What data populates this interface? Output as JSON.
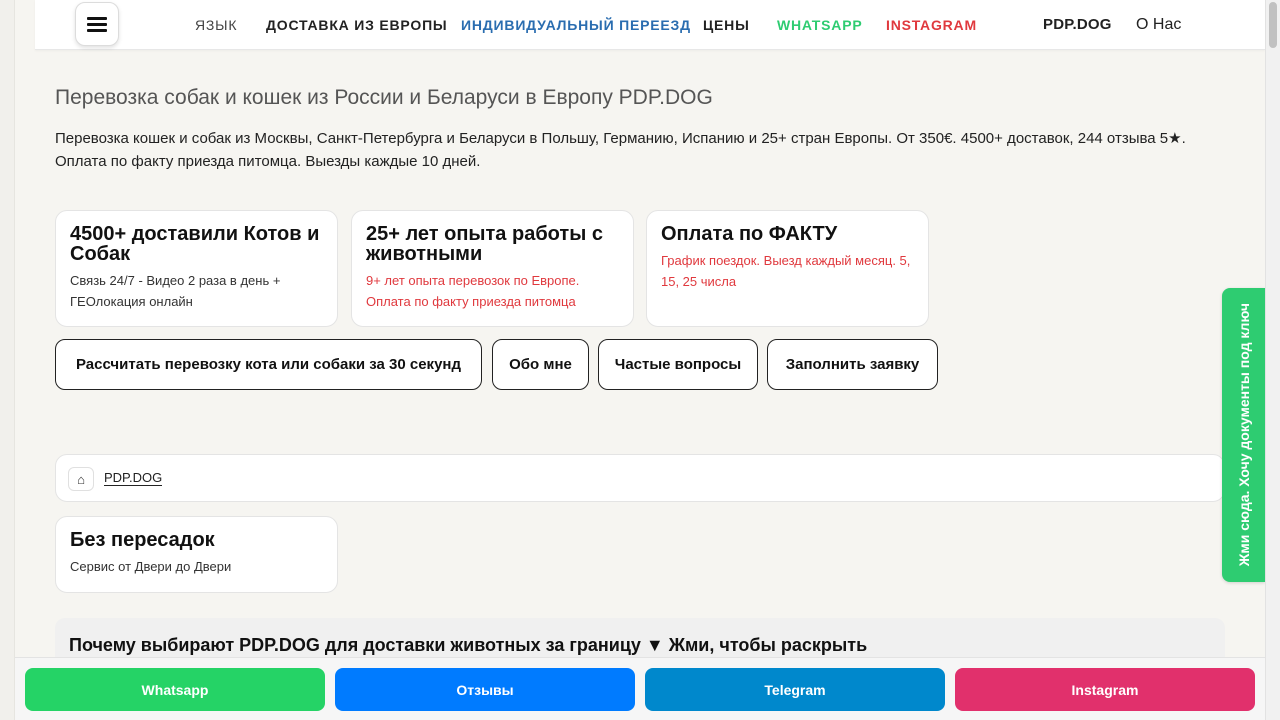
{
  "nav": {
    "menu_icon": "hamburger-menu-icon",
    "links": {
      "lang": "ЯЗЫК",
      "delivery": "ДОСТАВКА ИЗ ЕВРОПЫ",
      "individual": "ИНДИВИДУАЛЬНЫЙ ПЕРЕЕЗД",
      "prices": "ЦЕНЫ",
      "whatsapp": "WHATSAPP",
      "instagram": "INSTAGRAM",
      "brand": "PDP.DOG",
      "about": "О Нас"
    },
    "colors": {
      "individual": "#2a6db0",
      "whatsapp": "#2ecc71",
      "instagram": "#e0393e"
    }
  },
  "hero": {
    "title": "Перевозка собак и кошек из России и Беларуси в Европу PDP.DOG",
    "description": "Перевозка кошек и собак из Москвы, Санкт-Петербурга и Беларуси в Польшу, Германию, Испанию и 25+ стран Европы. От 350€. 4500+ доставок, 244 отзыва 5★. Оплата по факту приезда питомца. Выезды каждые 10 дней."
  },
  "cards": [
    {
      "title": "4500+ доставили Котов и Собак",
      "text": "Связь 24/7 - Видео 2 раза в день + ГЕОлокация онлайн"
    },
    {
      "title": "25+ лет опыта работы с животными",
      "text": "9+ лет опыта перевозок по Европе. Оплата по факту приезда питомца"
    },
    {
      "title": "Оплата по ФАКТУ",
      "text": "График поездок. Выезд каждый месяц. 5, 15, 25 числа"
    }
  ],
  "actions": {
    "calc": "Рассчитать перевозку кота или собаки за 30 секунд",
    "about": "Обо мне",
    "faq": "Частые вопросы",
    "apply": "Заполнить заявку"
  },
  "breadcrumb": {
    "home_icon": "home-icon",
    "home_glyph": "⌂",
    "current": "PDP.DOG"
  },
  "feature_card": {
    "title": "Без пересадок",
    "text": "Сервис от Двери до Двери"
  },
  "faq_toggle": {
    "text": "Почему выбирают PDP.DOG для доставки животных за границу ▼ Жми, чтобы раскрыть"
  },
  "side_tab": {
    "text": "Жми сюда. Хочу документы под ключ"
  },
  "bottom_bar": {
    "whatsapp": "Whatsapp",
    "reviews": "Отзывы",
    "telegram": "Telegram",
    "instagram": "Instagram"
  },
  "colors": {
    "red_text": "#e0393e",
    "whatsapp_green": "#25d366",
    "reviews_blue": "#007bff",
    "telegram_blue": "#0088cc",
    "instagram_pink": "#e1306c"
  }
}
